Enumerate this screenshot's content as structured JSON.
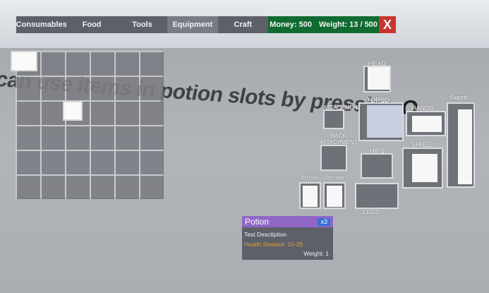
{
  "tabs": [
    {
      "label": "Consumables",
      "active": false
    },
    {
      "label": "Food",
      "active": false
    },
    {
      "label": "Tools",
      "active": false
    },
    {
      "label": "Equipment",
      "active": true
    },
    {
      "label": "Craft",
      "active": false
    }
  ],
  "status": {
    "money": "Money: 500",
    "weight": "Weight: 13 / 500"
  },
  "close_label": "X",
  "world_text": {
    "part1": "can use items in potion slots by pressing",
    "part2": "Q..."
  },
  "slots": {
    "head": "HEAD",
    "torso": "TORSO",
    "hands": "HANDS",
    "sword": "Sword",
    "shoulder": "ATTACHMENT",
    "back": "BACK\nATTACHMENT",
    "hips": "HIPS",
    "shield": "SHIELD",
    "potion1": "POTION",
    "potion2": "POTION",
    "legs": "LEGS"
  },
  "tooltip": {
    "title": "Potion",
    "count": "x3",
    "description": "Test Desctiption",
    "effect": "Health Restore: 10-25",
    "weight": "Weight: 1"
  },
  "colors": {
    "topbar": "#5d6068",
    "money_bg": "#0f6b2f",
    "close_bg": "#c9352f",
    "tooltip_header": "#8f66c6",
    "tooltip_effect": "#e2a13a"
  }
}
